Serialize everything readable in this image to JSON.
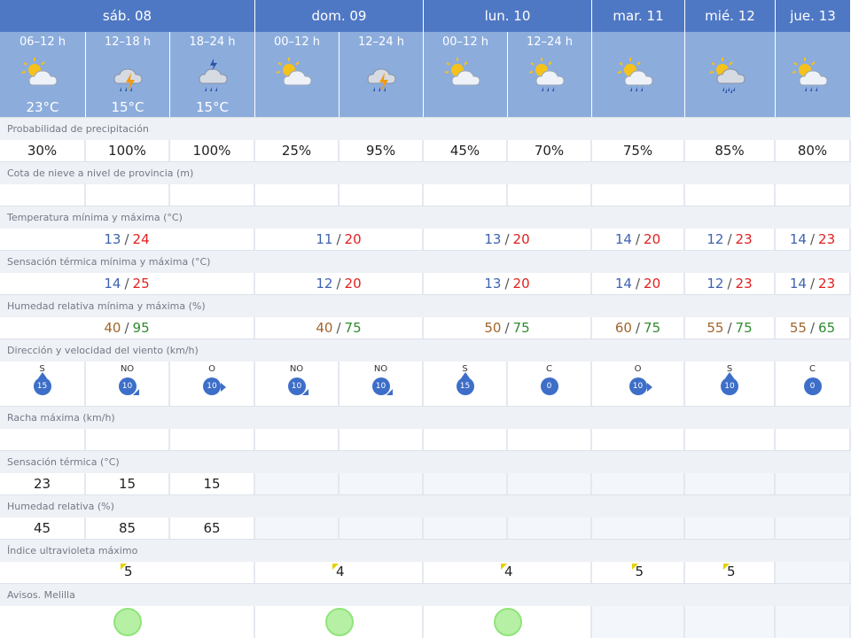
{
  "days": [
    {
      "label": "sáb. 08"
    },
    {
      "label": "dom. 09"
    },
    {
      "label": "lun. 10"
    },
    {
      "label": "mar. 11"
    },
    {
      "label": "mié. 12"
    },
    {
      "label": "jue. 13"
    }
  ],
  "periods": [
    {
      "label": "06–12 h",
      "icon": "partly-cloudy-icon",
      "temp": "23°C"
    },
    {
      "label": "12–18 h",
      "icon": "storm-rain-icon",
      "temp": "15°C"
    },
    {
      "label": "18–24 h",
      "icon": "thunder-rain-icon",
      "temp": "15°C"
    },
    {
      "label": "00–12 h",
      "icon": "partly-cloudy-icon",
      "temp": ""
    },
    {
      "label": "12–24 h",
      "icon": "storm-rain-icon",
      "temp": ""
    },
    {
      "label": "00–12 h",
      "icon": "partly-cloudy-icon",
      "temp": ""
    },
    {
      "label": "12–24 h",
      "icon": "sun-rain-icon",
      "temp": ""
    },
    {
      "label": "",
      "icon": "sun-rain-icon",
      "temp": ""
    },
    {
      "label": "",
      "icon": "sun-heavy-rain-icon",
      "temp": ""
    },
    {
      "label": "",
      "icon": "sun-rain-icon",
      "temp": ""
    }
  ],
  "rows": {
    "precip_label": "Probabilidad de precipitación",
    "precip": [
      "30%",
      "100%",
      "100%",
      "25%",
      "95%",
      "45%",
      "70%",
      "75%",
      "85%",
      "80%"
    ],
    "snow_label": "Cota de nieve a nivel de provincia (m)",
    "temp_label": "Temperatura mínima y máxima (°C)",
    "temp": [
      {
        "min": "13",
        "max": "24"
      },
      {
        "min": "11",
        "max": "20"
      },
      {
        "min": "13",
        "max": "20"
      },
      {
        "min": "14",
        "max": "20"
      },
      {
        "min": "12",
        "max": "23"
      },
      {
        "min": "14",
        "max": "23"
      }
    ],
    "feels_label": "Sensación térmica mínima y máxima (°C)",
    "feels": [
      {
        "min": "14",
        "max": "25"
      },
      {
        "min": "12",
        "max": "20"
      },
      {
        "min": "13",
        "max": "20"
      },
      {
        "min": "14",
        "max": "20"
      },
      {
        "min": "12",
        "max": "23"
      },
      {
        "min": "14",
        "max": "23"
      }
    ],
    "hum_label": "Humedad relativa mínima y máxima (%)",
    "hum": [
      {
        "min": "40",
        "max": "95"
      },
      {
        "min": "40",
        "max": "75"
      },
      {
        "min": "50",
        "max": "75"
      },
      {
        "min": "60",
        "max": "75"
      },
      {
        "min": "55",
        "max": "75"
      },
      {
        "min": "55",
        "max": "65"
      }
    ],
    "wind_label": "Dirección y velocidad del viento (km/h)",
    "wind": [
      {
        "dir": "S",
        "speed": "15",
        "arrow": "N"
      },
      {
        "dir": "NO",
        "speed": "10",
        "arrow": "SE"
      },
      {
        "dir": "O",
        "speed": "10",
        "arrow": "E"
      },
      {
        "dir": "NO",
        "speed": "10",
        "arrow": "SE"
      },
      {
        "dir": "NO",
        "speed": "10",
        "arrow": "SE"
      },
      {
        "dir": "S",
        "speed": "15",
        "arrow": "N"
      },
      {
        "dir": "C",
        "speed": "0",
        "arrow": ""
      },
      {
        "dir": "O",
        "speed": "10",
        "arrow": "E"
      },
      {
        "dir": "S",
        "speed": "10",
        "arrow": "N"
      },
      {
        "dir": "C",
        "speed": "0",
        "arrow": ""
      }
    ],
    "gust_label": "Racha máxima (km/h)",
    "st_label": "Sensación térmica (°C)",
    "st": [
      "23",
      "15",
      "15"
    ],
    "hr_label": "Humedad relativa (%)",
    "hr": [
      "45",
      "85",
      "65"
    ],
    "uv_label": "Índice ultravioleta máximo",
    "uv": [
      "5",
      "4",
      "4",
      "5",
      "5",
      ""
    ],
    "avisos_label": "Avisos. Melilla",
    "avisos": [
      "green",
      "green",
      "green",
      "",
      "",
      ""
    ]
  },
  "colors": {
    "header": "#4f78c4",
    "period": "#8cacdc",
    "min": "#3f63b0",
    "max": "#e02020",
    "aviso_green": "#b6f0a4"
  }
}
